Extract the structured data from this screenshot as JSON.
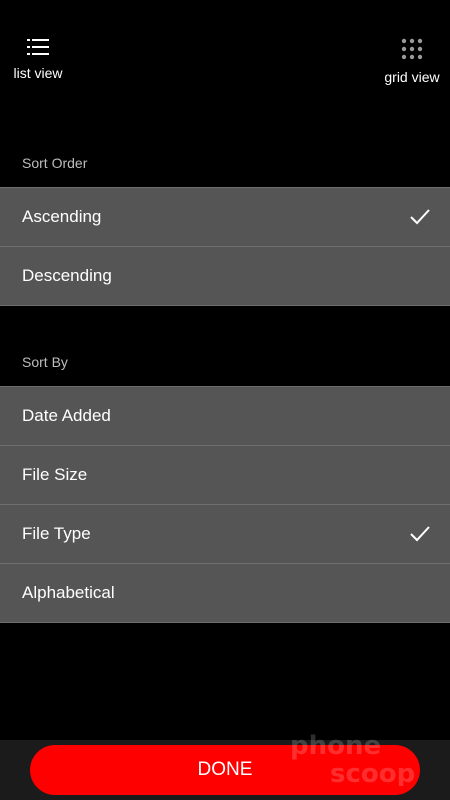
{
  "header": {
    "list_view_label": "list view",
    "grid_view_label": "grid view"
  },
  "sort_order": {
    "label": "Sort Order",
    "options": [
      {
        "label": "Ascending",
        "checked": true
      },
      {
        "label": "Descending",
        "checked": false
      }
    ]
  },
  "sort_by": {
    "label": "Sort By",
    "options": [
      {
        "label": "Date Added",
        "checked": false
      },
      {
        "label": "File Size",
        "checked": false
      },
      {
        "label": "File Type",
        "checked": true
      },
      {
        "label": "Alphabetical",
        "checked": false
      }
    ]
  },
  "footer": {
    "done_label": "DONE"
  },
  "colors": {
    "accent": "#ff0000",
    "row_bg": "#555555",
    "background": "#000000"
  },
  "icons": {
    "list_view": "list-icon",
    "grid_view": "grid-icon",
    "selected": "checkmark-icon"
  }
}
